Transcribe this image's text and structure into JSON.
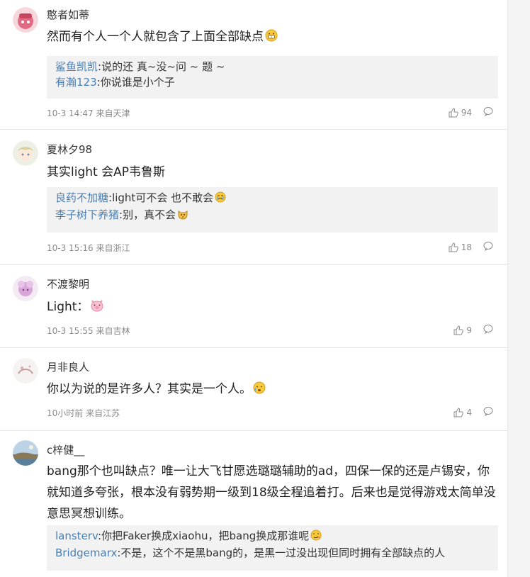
{
  "comments": [
    {
      "username": "憨者如蒂",
      "text": "然而有个人一个人就包含了上面全部缺点",
      "text_emoji": "grin-emoji",
      "replies": [
        {
          "name": "鲨鱼凯凯",
          "sep": ":",
          "text": "说的还 真~没~问 ~ 题 ~",
          "emoji": ""
        },
        {
          "name": "有瀚123",
          "sep": ":",
          "text": "你说谁是小个子",
          "emoji": ""
        }
      ],
      "meta": "10-3 14:47 来自天津",
      "likes": "94"
    },
    {
      "username": "夏林夕98",
      "text": "其实light 会AP韦鲁斯",
      "text_emoji": "",
      "replies": [
        {
          "name": "良药不加糖",
          "sep": ":",
          "text": ":light可不会 也不敢会",
          "emoji": "cry-emoji"
        },
        {
          "name": "李子树下养猪",
          "sep": ":",
          "text": "别，真不会",
          "emoji": "cat-emoji"
        }
      ],
      "meta": "10-3 15:16 来自浙江",
      "likes": "18"
    },
    {
      "username": "不渡黎明",
      "text": "Light：",
      "text_emoji": "pig-emoji",
      "replies": [],
      "meta": "10-3 15:55 来自吉林",
      "likes": "9"
    },
    {
      "username": "月非良人",
      "text": "你以为说的是许多人？其实是一个人。",
      "text_emoji": "tear-emoji",
      "replies": [],
      "meta": "10小时前 来自江苏",
      "likes": "4"
    },
    {
      "username": "c梓健__",
      "text": "bang那个也叫缺点？唯一让大飞甘愿选璐璐辅助的ad，四保一保的还是卢锡安，你就知道多夸张，根本没有弱势期一级到18级全程追着打。后来也是觉得游戏太简单没意思冥想训练。",
      "text_emoji": "",
      "replies": [
        {
          "name": "lansterv",
          "sep": ":",
          "text": "你把Faker换成xiaohu，把bang换成那谁呢",
          "emoji": "smirk-emoji"
        },
        {
          "name": "Bridgemarx",
          "sep": ":",
          "text": "不是，这个不是黑bang的，是黑一过没出现但同时拥有全部缺点的人",
          "emoji": ""
        }
      ],
      "meta": "",
      "likes": ""
    }
  ],
  "colors": {
    "reply_name": "#4a7fb5",
    "reply_bg": "#f2f2f2",
    "meta": "#8a8a8a"
  },
  "icons": {
    "like": "thumbs-up-icon",
    "reply": "comment-bubble-icon"
  }
}
